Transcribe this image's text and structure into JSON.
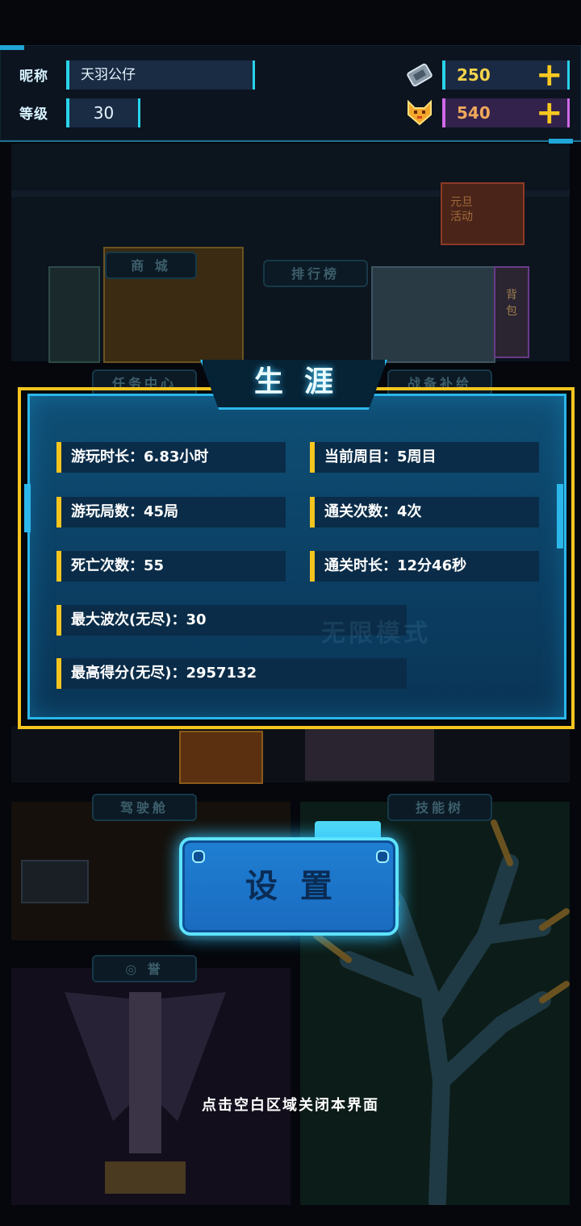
{
  "header": {
    "nickname_label": "昵称",
    "nickname_value": "天羽公仔",
    "level_label": "等级",
    "level_value": "30",
    "coins": "250",
    "gems": "540",
    "add_symbol": "+"
  },
  "rooms": {
    "shop": "商 城",
    "leaderboard": "排行榜",
    "event": "元旦活动",
    "backpack": "背包",
    "task_center": "任务中心",
    "supply": "战备补给",
    "endless": "无限模式",
    "cockpit": "驾驶舱",
    "skill_tree": "技能树",
    "archive": "◎ 誉"
  },
  "modal": {
    "title": "生涯",
    "stats": [
      {
        "text": "游玩时长：6.83小时"
      },
      {
        "text": "当前周目：5周目"
      },
      {
        "text": "游玩局数：45局"
      },
      {
        "text": "通关次数：4次"
      },
      {
        "text": "死亡次数：55"
      },
      {
        "text": "通关时长：12分46秒"
      },
      {
        "text": "最大波次(无尽)：30"
      },
      {
        "text": "最高得分(无尽)：2957132"
      }
    ]
  },
  "settings_button": "设置",
  "close_hint": "点击空白区域关闭本界面",
  "colors": {
    "accent_cyan": "#27d4ea",
    "accent_yellow": "#f5c51e",
    "modal_bg": "#0b3e62",
    "coin_text": "#f5d34a",
    "gem_text": "#f0a95a"
  },
  "icons": {
    "coin": "ticket-icon",
    "gem": "cat-face-icon",
    "add": "plus-icon"
  }
}
